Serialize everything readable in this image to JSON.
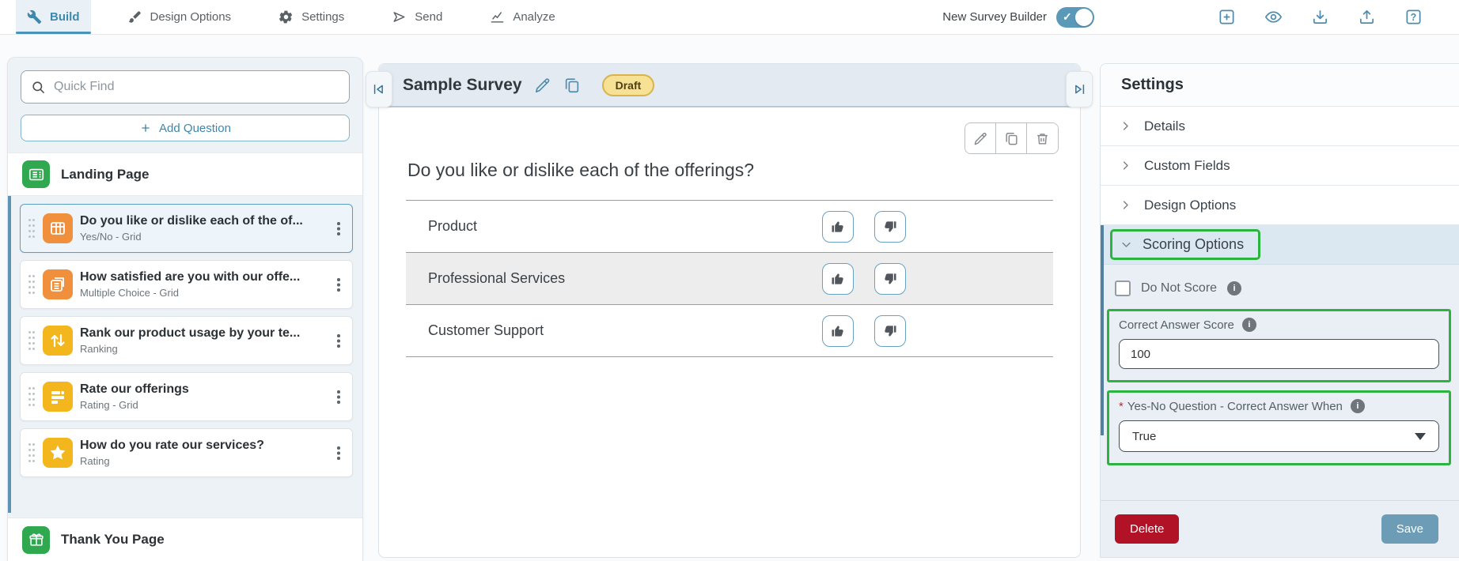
{
  "topnav": {
    "tabs": [
      {
        "label": "Build",
        "active": true
      },
      {
        "label": "Design Options",
        "active": false
      },
      {
        "label": "Settings",
        "active": false
      },
      {
        "label": "Send",
        "active": false
      },
      {
        "label": "Analyze",
        "active": false
      }
    ],
    "toggle_label": "New Survey Builder",
    "toggle_state": "on",
    "icons": [
      "add-icon",
      "preview-eye-icon",
      "download-icon",
      "upload-icon",
      "help-icon"
    ],
    "help_glyph": "?"
  },
  "sidebar": {
    "search_placeholder": "Quick Find",
    "add_question_label": "Add Question",
    "landing_page_label": "Landing Page",
    "thank_you_label": "Thank You Page",
    "questions": [
      {
        "title": "Do you like or dislike each of the of...",
        "type": "Yes/No - Grid",
        "icon": "grid-icon",
        "selected": true
      },
      {
        "title": "How satisfied are you with our offe...",
        "type": "Multiple Choice - Grid",
        "icon": "pages-icon",
        "selected": false
      },
      {
        "title": "Rank our product usage by your te...",
        "type": "Ranking",
        "icon": "rank-arrows-icon",
        "selected": false
      },
      {
        "title": "Rate our offerings",
        "type": "Rating - Grid",
        "icon": "rating-bars-icon",
        "selected": false
      },
      {
        "title": "How do you rate our services?",
        "type": "Rating",
        "icon": "star-icon",
        "selected": false
      }
    ]
  },
  "survey": {
    "title": "Sample Survey",
    "status_badge": "Draft",
    "question_title": "Do you like or dislike each of the offerings?",
    "rows": [
      {
        "label": "Product"
      },
      {
        "label": "Professional Services"
      },
      {
        "label": "Customer Support"
      }
    ],
    "toolbar_icons": [
      "edit-pencil-icon",
      "copy-icon",
      "trash-icon"
    ]
  },
  "settings_panel": {
    "title": "Settings",
    "sections": [
      "Details",
      "Custom Fields",
      "Design Options"
    ],
    "scoring_section_label": "Scoring Options",
    "do_not_score_label": "Do Not Score",
    "correct_answer_score_label": "Correct Answer Score",
    "correct_answer_score_value": "100",
    "yes_no_required_mark": "*",
    "yes_no_label": "Yes-No Question - Correct Answer When",
    "yes_no_value": "True",
    "delete_label": "Delete",
    "save_label": "Save"
  },
  "colors": {
    "accent_blue": "#4e8cab",
    "highlight_green": "#2db440",
    "delete_red": "#b11226",
    "save_blue": "#6d9cb6",
    "draft_yellow_bg": "#f7e194",
    "draft_yellow_border": "#d8b44e",
    "orange_icon": "#f08f3c",
    "yellow_icon": "#f3b71d",
    "green_icon": "#2fa84f",
    "row_stripe": "#ededed",
    "row_divider_blue": "#7da4c0"
  }
}
